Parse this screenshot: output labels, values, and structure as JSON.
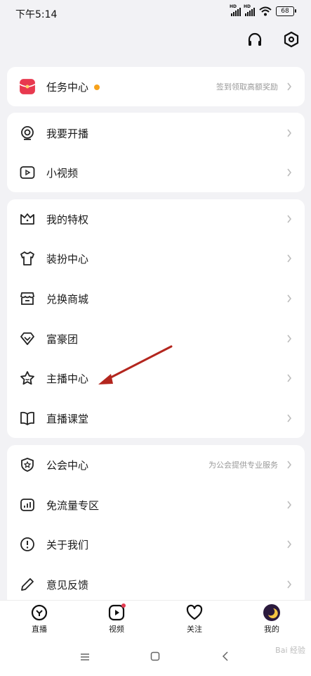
{
  "status_bar": {
    "time": "下午5:14",
    "hd1": "HD",
    "hd2": "HD",
    "battery": "68"
  },
  "accent_color": "#e23b50",
  "task": {
    "label": "任务中心",
    "hint": "签到领取高额奖励"
  },
  "group1": [
    {
      "label": "我要开播",
      "icon": "live-camera-icon"
    },
    {
      "label": "小视频",
      "icon": "video-play-icon"
    }
  ],
  "group2": [
    {
      "label": "我的特权",
      "icon": "crown-icon"
    },
    {
      "label": "装扮中心",
      "icon": "tshirt-icon"
    },
    {
      "label": "兑换商城",
      "icon": "store-icon"
    },
    {
      "label": "富豪团",
      "icon": "diamond-icon"
    },
    {
      "label": "主播中心",
      "icon": "star-icon"
    },
    {
      "label": "直播课堂",
      "icon": "book-icon"
    }
  ],
  "group3": [
    {
      "label": "公会中心",
      "hint": "为公会提供专业服务",
      "icon": "shield-star-icon"
    },
    {
      "label": "免流量专区",
      "icon": "data-chart-icon"
    },
    {
      "label": "关于我们",
      "icon": "info-circle-icon"
    },
    {
      "label": "意见反馈",
      "icon": "pen-icon"
    }
  ],
  "tabs": [
    {
      "label": "直播",
      "icon": "live-tab-icon"
    },
    {
      "label": "视频",
      "icon": "video-tab-icon"
    },
    {
      "label": "关注",
      "icon": "heart-icon"
    },
    {
      "label": "我的",
      "icon": "avatar"
    }
  ],
  "watermark": "Bai 经验"
}
